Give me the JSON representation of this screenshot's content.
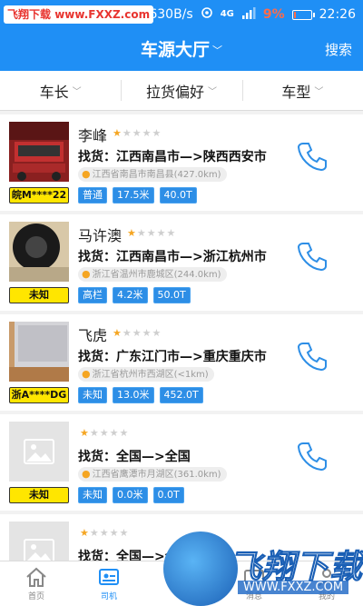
{
  "status_bar": {
    "watermark_badge_part1": "飞翔下载",
    "watermark_badge_part2": "www.FXXZ.com",
    "speed": "630B/s",
    "network": "4G",
    "battery_pct": "9%",
    "battery_level": 0.09,
    "time": "22:26"
  },
  "header": {
    "title": "车源大厅",
    "title_chevron": "﹀",
    "search_label": "搜索"
  },
  "filters": [
    {
      "label": "车长",
      "chevron": "﹀"
    },
    {
      "label": "拉货偏好",
      "chevron": "﹀"
    },
    {
      "label": "车型",
      "chevron": "﹀"
    }
  ],
  "cards": [
    {
      "name": "李峰",
      "rating": 1,
      "stars_on": "★",
      "stars_off": "★★★★",
      "route": "找货：江西南昌市—>陕西西安市",
      "location": "江西省南昌市南昌县(427.0km)",
      "plate": "皖M****22",
      "tags": [
        "普通",
        "17.5米",
        "40.0T"
      ],
      "photo": "truck"
    },
    {
      "name": "马许澳",
      "rating": 1,
      "stars_on": "★",
      "stars_off": "★★★★",
      "route": "找货：江西南昌市—>浙江杭州市",
      "location": "浙江省温州市鹿城区(244.0km)",
      "plate": "未知",
      "tags": [
        "高栏",
        "4.2米",
        "50.0T"
      ],
      "photo": "tire"
    },
    {
      "name": "飞虎",
      "rating": 1,
      "stars_on": "★",
      "stars_off": "★★★★",
      "route": "找货：广东江门市—>重庆重庆市",
      "location": "浙江省杭州市西湖区(<1km)",
      "plate": "浙A****DG",
      "tags": [
        "未知",
        "13.0米",
        "452.0T"
      ],
      "photo": "laptop"
    },
    {
      "name": "",
      "rating": 1,
      "stars_on": "★",
      "stars_off": "★★★★",
      "route": "找货：全国—>全国",
      "location": "江西省鹰潭市月湖区(361.0km)",
      "plate": "未知",
      "tags": [
        "未知",
        "0.0米",
        "0.0T"
      ],
      "photo": "placeholder"
    },
    {
      "name": "",
      "rating": 1,
      "stars_on": "★",
      "stars_off": "★★★★",
      "route": "找货：全国—>全",
      "location": "",
      "plate": "",
      "tags": [],
      "photo": "placeholder"
    }
  ],
  "tabbar": [
    {
      "label": "首页",
      "icon": "home-icon"
    },
    {
      "label": "司机",
      "icon": "driver-card-icon"
    },
    {
      "label": "",
      "icon": "center-round-icon"
    },
    {
      "label": "消息",
      "icon": "message-icon"
    },
    {
      "label": "我的",
      "icon": "profile-icon"
    }
  ],
  "watermark": {
    "title": "飞翔下载",
    "url": "WWW.FXXZ.COM"
  },
  "colors": {
    "brand_blue": "#1f8ff5",
    "star": "#f5a623",
    "plate_yellow": "#ffe600",
    "tag_blue": "#2d8ee6",
    "battery_low": "#ff6b4a"
  }
}
